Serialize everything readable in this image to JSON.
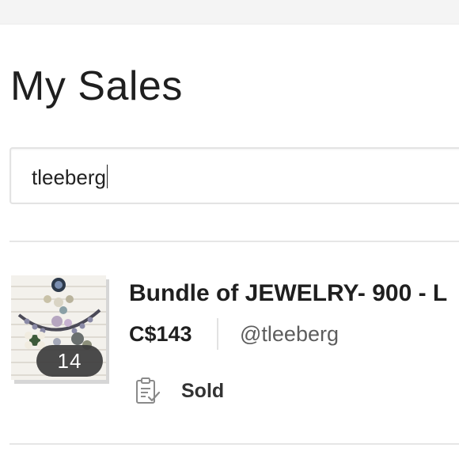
{
  "header": {
    "title": "My Sales"
  },
  "search": {
    "value": "tleeberg"
  },
  "listing": {
    "title": "Bundle of JEWELRY- 900 - L",
    "price": "C$143",
    "seller": "@tleeberg",
    "photo_count": "14",
    "status": "Sold",
    "status_icon": "clipboard-check-icon"
  }
}
